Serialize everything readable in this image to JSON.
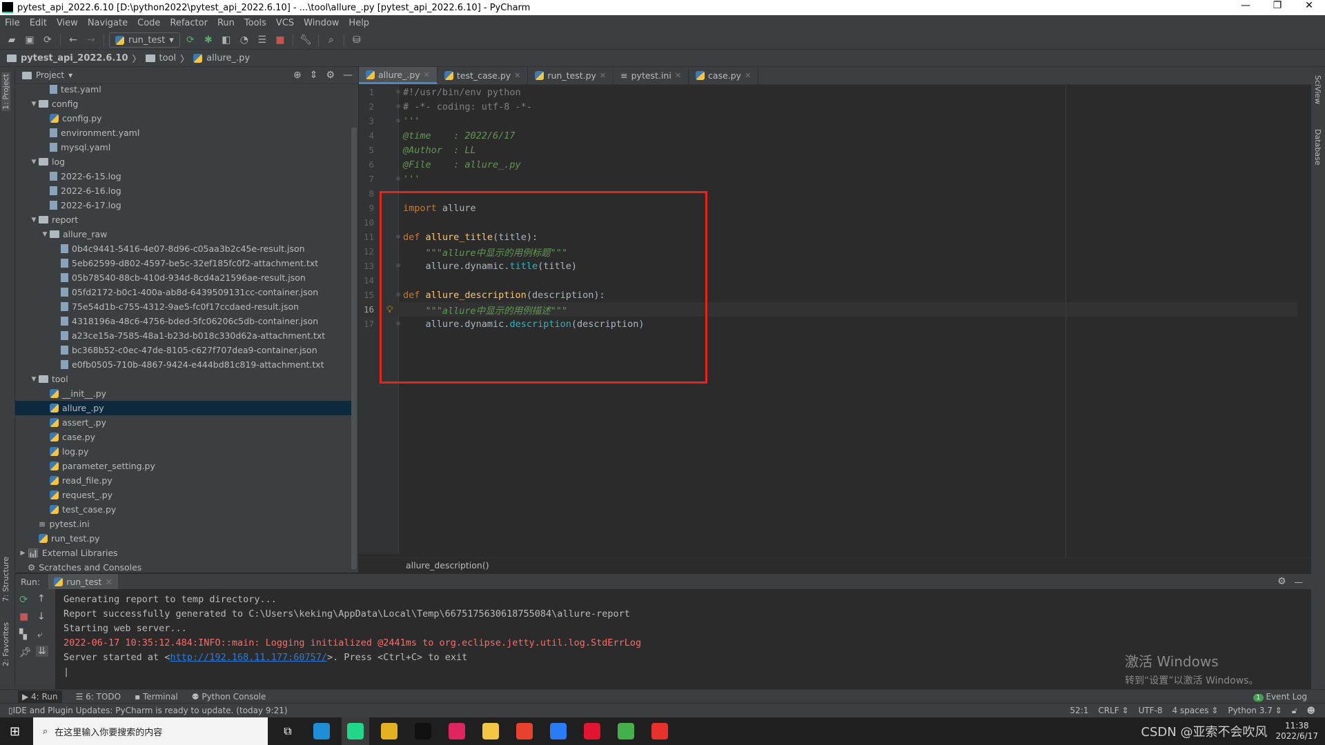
{
  "window": {
    "title": "pytest_api_2022.6.10 [D:\\python2022\\pytest_api_2022.6.10] - ...\\tool\\allure_.py [pytest_api_2022.6.10] - PyCharm",
    "logo": "PC",
    "controls": [
      "—",
      "❐",
      "✕"
    ]
  },
  "menu": [
    "File",
    "Edit",
    "View",
    "Navigate",
    "Code",
    "Refactor",
    "Run",
    "Tools",
    "VCS",
    "Window",
    "Help"
  ],
  "toolbar": {
    "run_config": "run_test",
    "icons": [
      "open-icon",
      "save-icon",
      "sync-icon",
      "back-icon",
      "forward-icon",
      "rerun-icon",
      "debug-icon",
      "coverage-icon",
      "profile-icon",
      "concurrency-icon",
      "stop-icon",
      "wrench-icon",
      "search-icon",
      "vcs-icon"
    ]
  },
  "breadcrumb": [
    "pytest_api_2022.6.10",
    "tool",
    "allure_.py"
  ],
  "left_stripe": [
    "1: Project",
    "7: Structure",
    "2: Favorites"
  ],
  "right_stripe": [
    "SciView",
    "Database"
  ],
  "project": {
    "title": "Project",
    "tree": [
      {
        "label": "test.yaml",
        "level": 2,
        "type": "yaml"
      },
      {
        "label": "config",
        "level": 1,
        "type": "folder",
        "open": true
      },
      {
        "label": "config.py",
        "level": 2,
        "type": "py"
      },
      {
        "label": "environment.yaml",
        "level": 2,
        "type": "yaml"
      },
      {
        "label": "mysql.yaml",
        "level": 2,
        "type": "yaml"
      },
      {
        "label": "log",
        "level": 1,
        "type": "folder",
        "open": true
      },
      {
        "label": "2022-6-15.log",
        "level": 2,
        "type": "log"
      },
      {
        "label": "2022-6-16.log",
        "level": 2,
        "type": "log"
      },
      {
        "label": "2022-6-17.log",
        "level": 2,
        "type": "log"
      },
      {
        "label": "report",
        "level": 1,
        "type": "folder",
        "open": true
      },
      {
        "label": "allure_raw",
        "level": 2,
        "type": "folder",
        "open": true
      },
      {
        "label": "0b4c9441-5416-4e07-8d96-c05aa3b2c45e-result.json",
        "level": 3,
        "type": "file"
      },
      {
        "label": "5eb62599-d802-4597-be5c-32ef185fc0f2-attachment.txt",
        "level": 3,
        "type": "file"
      },
      {
        "label": "05b78540-88cb-410d-934d-8cd4a21596ae-result.json",
        "level": 3,
        "type": "file"
      },
      {
        "label": "05fd2172-b0c1-400a-ab8d-6439509131cc-container.json",
        "level": 3,
        "type": "file"
      },
      {
        "label": "75e54d1b-c755-4312-9ae5-fc0f17ccdaed-result.json",
        "level": 3,
        "type": "file"
      },
      {
        "label": "4318196a-48c6-4756-bded-5fc06206c5db-container.json",
        "level": 3,
        "type": "file"
      },
      {
        "label": "a23ce15a-7585-48a1-b23d-b018c330d62a-attachment.txt",
        "level": 3,
        "type": "file"
      },
      {
        "label": "bc368b52-c0ec-47de-8105-c627f707dea9-container.json",
        "level": 3,
        "type": "file"
      },
      {
        "label": "e0fb0505-710b-4867-9424-e444bd81c819-attachment.txt",
        "level": 3,
        "type": "file"
      },
      {
        "label": "tool",
        "level": 1,
        "type": "folder",
        "open": true
      },
      {
        "label": "__init__.py",
        "level": 2,
        "type": "py"
      },
      {
        "label": "allure_.py",
        "level": 2,
        "type": "py",
        "selected": true
      },
      {
        "label": "assert_.py",
        "level": 2,
        "type": "py"
      },
      {
        "label": "case.py",
        "level": 2,
        "type": "py"
      },
      {
        "label": "log.py",
        "level": 2,
        "type": "py"
      },
      {
        "label": "parameter_setting.py",
        "level": 2,
        "type": "py"
      },
      {
        "label": "read_file.py",
        "level": 2,
        "type": "py"
      },
      {
        "label": "request_.py",
        "level": 2,
        "type": "py"
      },
      {
        "label": "test_case.py",
        "level": 2,
        "type": "py"
      },
      {
        "label": "pytest.ini",
        "level": 1,
        "type": "ini"
      },
      {
        "label": "run_test.py",
        "level": 1,
        "type": "py"
      },
      {
        "label": "External Libraries",
        "level": 0,
        "type": "lib",
        "open": false
      },
      {
        "label": "Scratches and Consoles",
        "level": 0,
        "type": "scratch"
      }
    ]
  },
  "editor": {
    "tabs": [
      {
        "label": "allure_.py",
        "active": true
      },
      {
        "label": "test_case.py"
      },
      {
        "label": "run_test.py"
      },
      {
        "label": "pytest.ini"
      },
      {
        "label": "case.py"
      }
    ],
    "current_line": 16,
    "lines": [
      [
        [
          "#!/usr/bin/env python",
          "cm"
        ]
      ],
      [
        [
          "# -*- coding: utf-8 -*-",
          "cm"
        ]
      ],
      [
        [
          "'''",
          "doc"
        ]
      ],
      [
        [
          "@time    : 2022/6/17",
          "doc"
        ]
      ],
      [
        [
          "@Author  : LL",
          "doc"
        ]
      ],
      [
        [
          "@File    : allure_.py",
          "doc"
        ]
      ],
      [
        [
          "'''",
          "doc"
        ]
      ],
      [],
      [
        [
          "import",
          "kw"
        ],
        [
          " allure",
          "tx"
        ]
      ],
      [],
      [
        [
          "def ",
          "kw"
        ],
        [
          "allure_title",
          "fn"
        ],
        [
          "(title):",
          "tx"
        ]
      ],
      [
        [
          "    ",
          "tx"
        ],
        [
          "\"\"\"allure中显示的用例标题\"\"\"",
          "ds"
        ]
      ],
      [
        [
          "    allure.dynamic.",
          "tx"
        ],
        [
          "title",
          "mt"
        ],
        [
          "(title)",
          "tx"
        ]
      ],
      [],
      [
        [
          "def ",
          "kw"
        ],
        [
          "allure_description",
          "fn"
        ],
        [
          "(description):",
          "tx"
        ]
      ],
      [
        [
          "    ",
          "tx"
        ],
        [
          "\"\"\"allure中显示的用例描述\"\"\"",
          "ds"
        ]
      ],
      [
        [
          "    allure.dynamic.",
          "tx"
        ],
        [
          "description",
          "mt"
        ],
        [
          "(description)",
          "tx"
        ]
      ]
    ],
    "footer_crumb": "allure_description()",
    "highlight_color": "#e8221c"
  },
  "run": {
    "label": "Run:",
    "tab": "run_test",
    "console": [
      {
        "text": "Generating report to temp directory...",
        "kind": "normal"
      },
      {
        "text": "Report successfully generated to C:\\Users\\keking\\AppData\\Local\\Temp\\6675175630618755084\\allure-report",
        "kind": "normal"
      },
      {
        "text": "Starting web server...",
        "kind": "normal"
      },
      {
        "text": "2022-06-17 10:35:12.484:INFO::main: Logging initialized @2441ms to org.eclipse.jetty.util.log.StdErrLog",
        "kind": "error"
      }
    ],
    "server_prefix": "Server started at <",
    "server_link": "http://192.168.11.177:60757/",
    "server_suffix": ">. Press <Ctrl+C> to exit"
  },
  "watermark": {
    "line1": "激活 Windows",
    "line2": "转到“设置”以激活 Windows。"
  },
  "bottom_tabs": [
    "4: Run",
    "6: TODO",
    "Terminal",
    "Python Console"
  ],
  "event_log": {
    "label": "Event Log",
    "count": "1"
  },
  "status": {
    "message": "IDE and Plugin Updates: PyCharm is ready to update. (today 9:21)",
    "position": "52:1",
    "line_sep": "CRLF",
    "encoding": "UTF-8",
    "indent": "4 spaces",
    "interpreter": "Python 3.7"
  },
  "taskbar": {
    "search_placeholder": "在这里输入你要搜索的内容",
    "time": "11:38",
    "date": "2022/6/17",
    "overlay_text": "CSDN @亚索不会吹风",
    "apps": [
      {
        "name": "edge",
        "color": "#1e8fd6"
      },
      {
        "name": "pycharm",
        "color": "#21d789"
      },
      {
        "name": "chrome",
        "color": "#e4b120"
      },
      {
        "name": "terminal",
        "color": "#111111"
      },
      {
        "name": "pen",
        "color": "#e0245e"
      },
      {
        "name": "explorer",
        "color": "#f3c744"
      },
      {
        "name": "xmind",
        "color": "#e8412c"
      },
      {
        "name": "feishu",
        "color": "#2a7cf6"
      },
      {
        "name": "youdao",
        "color": "#e3142f"
      },
      {
        "name": "anaconda",
        "color": "#43b049"
      },
      {
        "name": "wps",
        "color": "#e8312b"
      }
    ]
  }
}
